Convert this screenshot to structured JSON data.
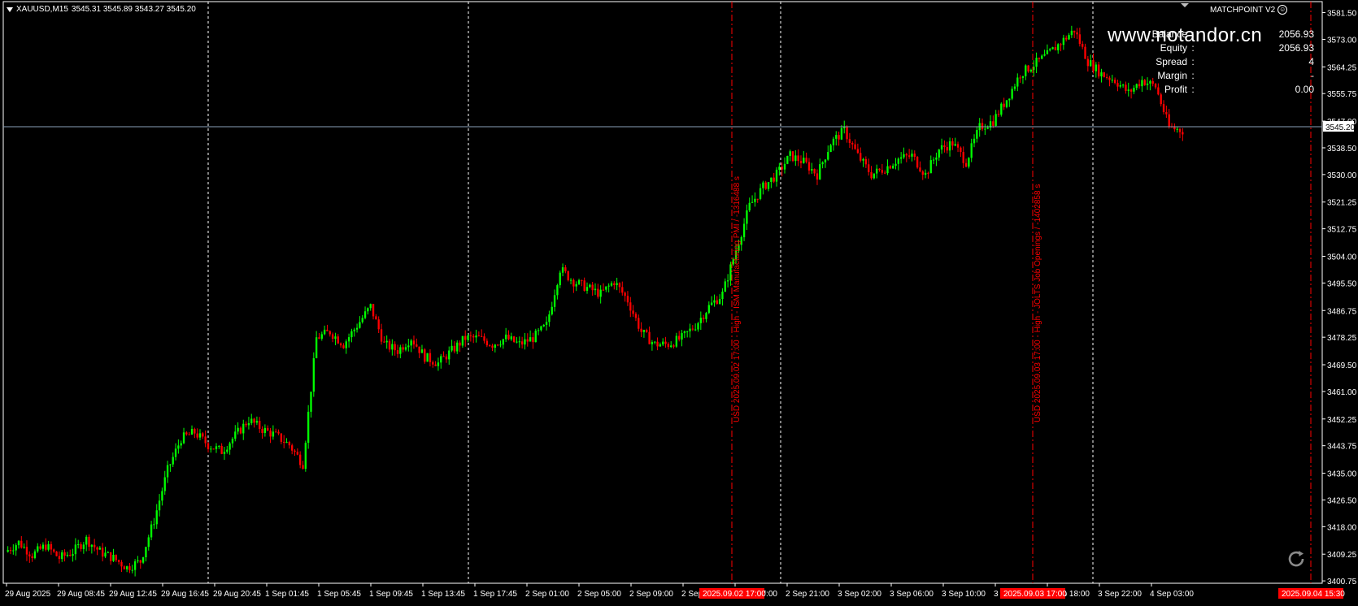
{
  "header": {
    "symbol": "XAUUSD,M15",
    "ohlc": "3545.31 3545.89 3543.27 3545.20"
  },
  "ea": {
    "title": "MATCHPOINT V2",
    "icon": "smiley-icon"
  },
  "account": [
    {
      "label": "Balance",
      "value": "2056.93"
    },
    {
      "label": "Equity",
      "value": "2056.93"
    },
    {
      "label": "Spread",
      "value": "4"
    },
    {
      "label": "Margin",
      "value": "-"
    },
    {
      "label": "Profit",
      "value": "0.00"
    }
  ],
  "watermark": "www.notandor.cn",
  "colors": {
    "background": "#000000",
    "bull": "#00ff00",
    "bear": "#ff0000",
    "grid": "#ffffff",
    "price_line": "#8aa0b8",
    "event_line": "#ff0000",
    "axis_text": "#ffffff"
  },
  "chart_data": {
    "type": "candlestick",
    "symbol": "XAUUSD",
    "timeframe": "M15",
    "ylim": [
      3400.0,
      3585.0
    ],
    "y_ticks": [
      "3581.50",
      "3573.00",
      "3564.25",
      "3555.75",
      "3547.00",
      "3538.50",
      "3530.00",
      "3521.25",
      "3512.75",
      "3504.00",
      "3495.50",
      "3486.75",
      "3478.25",
      "3469.50",
      "3461.00",
      "3452.25",
      "3443.75",
      "3435.00",
      "3426.50",
      "3418.00",
      "3409.25",
      "3400.75"
    ],
    "x_ticks": [
      "29 Aug 2025",
      "29 Aug 08:45",
      "29 Aug 12:45",
      "29 Aug 16:45",
      "29 Aug 20:45",
      "1 Sep 01:45",
      "1 Sep 05:45",
      "1 Sep 09:45",
      "1 Sep 13:45",
      "1 Sep 17:45",
      "2 Sep 01:00",
      "2 Sep 05:00",
      "2 Sep 09:00",
      "2 Sep 13:00",
      "2 Sep 17:00",
      "2 Sep 21:00",
      "3 Sep 02:00",
      "3 Sep 06:00",
      "3 Sep 10:00",
      "3 Sep 14:00",
      "3 Sep 18:00",
      "3 Sep 22:00",
      "4 Sep 03:00"
    ],
    "current_price": "3545.20",
    "close_path": [
      3410,
      3413,
      3409,
      3412,
      3408,
      3410,
      3414,
      3410,
      3408,
      3405,
      3407,
      3420,
      3436,
      3446,
      3448,
      3444,
      3442,
      3447,
      3452,
      3449,
      3447,
      3444,
      3438,
      3478,
      3480,
      3476,
      3482,
      3488,
      3476,
      3474,
      3478,
      3472,
      3470,
      3474,
      3478,
      3478,
      3476,
      3478,
      3476,
      3478,
      3482,
      3500,
      3496,
      3494,
      3492,
      3496,
      3490,
      3480,
      3476,
      3476,
      3478,
      3482,
      3488,
      3492,
      3506,
      3520,
      3526,
      3530,
      3536,
      3534,
      3530,
      3540,
      3544,
      3536,
      3530,
      3532,
      3535,
      3536,
      3530,
      3538,
      3540,
      3534,
      3545,
      3547,
      3554,
      3562,
      3565,
      3568,
      3572,
      3576,
      3566,
      3562,
      3560,
      3556,
      3560,
      3558,
      3545,
      3544
    ],
    "session_separators": [
      "29 Aug 20:45",
      "1 Sep 17:45",
      "2 Sep 21:00",
      "3 Sep 22:00"
    ],
    "events": [
      {
        "time_label": "2025.09.02 17:00",
        "text": "USD 2025.09.02 17:00 - High - ISM Manufacturing PMI / -1316488 s"
      },
      {
        "time_label": "2025.09.03 17:00",
        "text": "USD 2025.09.03 17:00 - High - JOLTS Job Openings / -1402858 s"
      },
      {
        "time_label": "2025.09.04 15:30",
        "text": ""
      }
    ]
  }
}
